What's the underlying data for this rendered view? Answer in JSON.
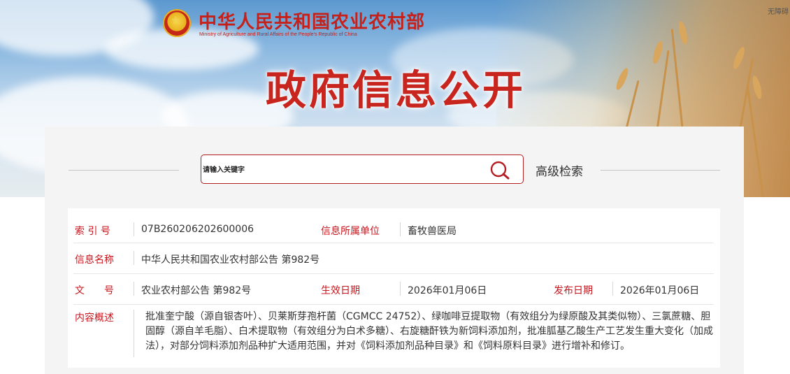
{
  "header": {
    "ministry_name_cn": "中华人民共和国农业农村部",
    "ministry_name_en": "Ministry of Agriculture and Rural Affairs of the People's Republic of China",
    "accessibility": "无障碍",
    "page_heading": "政府信息公开"
  },
  "search": {
    "placeholder": "请输入关键字",
    "advanced_label": "高级检索"
  },
  "info": {
    "index_label": "索 引 号",
    "index_value": "07B260206202600006",
    "unit_label": "信息所属单位",
    "unit_value": "畜牧兽医局",
    "name_label": "信息名称",
    "name_value": "中华人民共和国农业农村部公告 第982号",
    "doc_no_label": "文　　号",
    "doc_no_value": "农业农村部公告 第982号",
    "effective_label": "生效日期",
    "effective_value": "2026年01月06日",
    "publish_label": "发布日期",
    "publish_value": "2026年01月06日",
    "summary_label": "内容概述",
    "summary_value": "批准奎宁酸（源自银杏叶）、贝莱斯芽孢杆菌（CGMCC 24752）、绿咖啡豆提取物（有效组分为绿原酸及其类似物）、三氯蔗糖、胆固醇（源自羊毛脂）、白术提取物（有效组分为白术多糖）、右旋糖酐铁为新饲料添加剂，批准胍基乙酸生产工艺发生重大变化（加成法），对部分饲料添加剂品种扩大适用范围，并对《饲料添加剂品种目录》和《饲料原料目录》进行增补和修订。"
  },
  "colors": {
    "brand_red": "#c6201a",
    "label_red": "#c8161e"
  },
  "icons": {
    "search": "search-icon",
    "emblem": "national-emblem-icon"
  }
}
